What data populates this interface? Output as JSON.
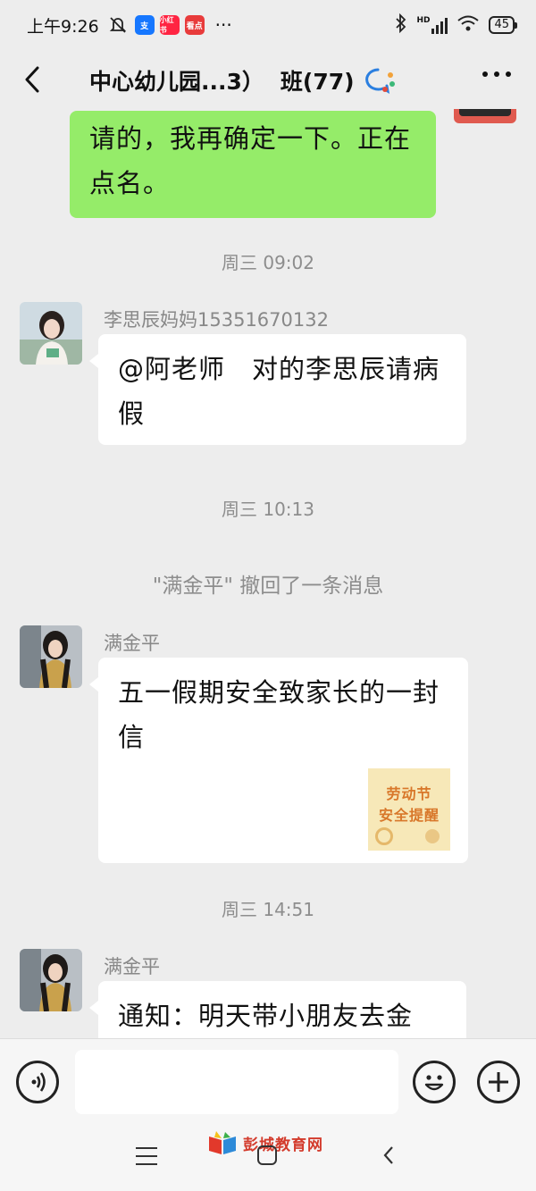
{
  "status_bar": {
    "time": "上午9:26",
    "app_badge_1": "小红书",
    "app_badge_2": "看点",
    "more": "···",
    "network": "HD",
    "battery": "45"
  },
  "header": {
    "title_group": "中心幼儿园...3）",
    "title_class": "班(77)"
  },
  "messages": [
    {
      "type": "outgoing",
      "text": "请的，我再确定一下。正在点名。"
    },
    {
      "type": "time",
      "text": "周三 09:02"
    },
    {
      "type": "incoming",
      "sender": "李思辰妈妈15351670132",
      "text": "@阿老师　对的李思辰请病假"
    },
    {
      "type": "time",
      "text": "周三 10:13"
    },
    {
      "type": "system",
      "text": "\"满金平\" 撤回了一条消息"
    },
    {
      "type": "incoming-card",
      "sender": "满金平",
      "text": "五一假期安全致家长的一封信",
      "thumb_line1": "劳动节",
      "thumb_line2": "安全提醒"
    },
    {
      "type": "time",
      "text": "周三 14:51"
    },
    {
      "type": "incoming",
      "sender": "满金平",
      "text": "通知：明天带小朋友去金"
    }
  ],
  "input": {
    "placeholder": "",
    "value": ""
  },
  "watermark": "彭城教育网",
  "colors": {
    "outgoing_bubble": "#95ec69",
    "incoming_bubble": "#ffffff",
    "background": "#ededed"
  }
}
